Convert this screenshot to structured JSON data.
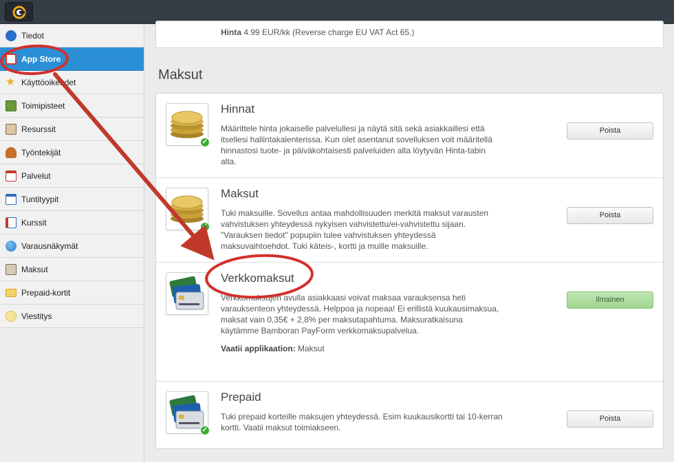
{
  "topbar": {
    "logo_icon": "brand-logo-icon"
  },
  "sidebar": {
    "items": [
      {
        "label": "Tiedot",
        "icon": "info-icon",
        "color": "#2a6fc9"
      },
      {
        "label": "App Store",
        "icon": "store-icon",
        "color": "#d23b2a",
        "active": true
      },
      {
        "label": "Käyttöoikeudet",
        "icon": "star-icon",
        "color": "#e5b52a"
      },
      {
        "label": "Toimipisteet",
        "icon": "location-icon",
        "color": "#6a9a3a"
      },
      {
        "label": "Resurssit",
        "icon": "resource-icon",
        "color": "#8a6a4a"
      },
      {
        "label": "Työntekijät",
        "icon": "people-icon",
        "color": "#c8702a"
      },
      {
        "label": "Palvelut",
        "icon": "calendar-icon",
        "color": "#c0392b"
      },
      {
        "label": "Tuntityypit",
        "icon": "calendar-grid-icon",
        "color": "#2f6db5"
      },
      {
        "label": "Kurssit",
        "icon": "course-icon",
        "color": "#2f6db5"
      },
      {
        "label": "Varausnäkymät",
        "icon": "globe-icon",
        "color": "#2a7dc9"
      },
      {
        "label": "Maksut",
        "icon": "payments-icon",
        "color": "#7a6a4a"
      },
      {
        "label": "Prepaid-kortit",
        "icon": "card-icon",
        "color": "#d9a62a"
      },
      {
        "label": "Viestitys",
        "icon": "message-icon",
        "color": "#e0c14a"
      }
    ]
  },
  "top_card": {
    "price_label": "Hinta",
    "price_text": "4.99 EUR/kk (Reverse charge EU VAT Act 65.)"
  },
  "section": {
    "title": "Maksut"
  },
  "apps": [
    {
      "title": "Hinnat",
      "description": "Määrittele hinta jokaiselle palvelullesi ja näytä sitä sekä asiakkaillesi että itsellesi hallintakalenterissa. Kun olet asentanut sovelluksen voit määritellä hinnastosi tuote- ja päiväkohtaisesti palveluiden alta löytyvän Hinta-tabin alta.",
      "button": "Poista",
      "icon": "coins-icon",
      "installed": true
    },
    {
      "title": "Maksut",
      "description": "Tuki maksuille. Sovellus antaa mahdollisuuden merkitä maksut varausten vahvistuksen yhteydessä nykyisen vahvistettu/ei-vahvistettu sijaan. \"Varauksen tiedot\" popupiin tulee vahvistuksen yhteydessä maksuvaihtoehdot. Tuki käteis-, kortti ja muille maksuille.",
      "button": "Poista",
      "icon": "coins-icon",
      "installed": true
    },
    {
      "title": "Verkkomaksut",
      "description": "Verkkomaksujen avulla asiakkaasi voivat maksaa varauksensa heti varauksenteon yhteydessä. Helppoa ja nopeaa! Ei erillistä kuukausimaksua, maksat vain 0,35€ + 2,8% per maksutapahtuma. Maksuratkaisuna käytämme Bamboran PayForm verkkomaksupalvelua.",
      "requires_label": "Vaatii applikaation:",
      "requires_value": "Maksut",
      "button": "Ilmainen",
      "icon": "credit-cards-icon",
      "installed": false
    },
    {
      "title": "Prepaid",
      "description": "Tuki prepaid korteille maksujen yhteydessä. Esim kuukausikortti tai 10-kerran kortti. Vaatii maksut toimiakseen.",
      "button": "Poista",
      "icon": "credit-cards-icon",
      "installed": true
    }
  ],
  "colors": {
    "accent": "#2b8fd6",
    "annotation": "#d0312d",
    "free_button": "#a8d99a"
  }
}
